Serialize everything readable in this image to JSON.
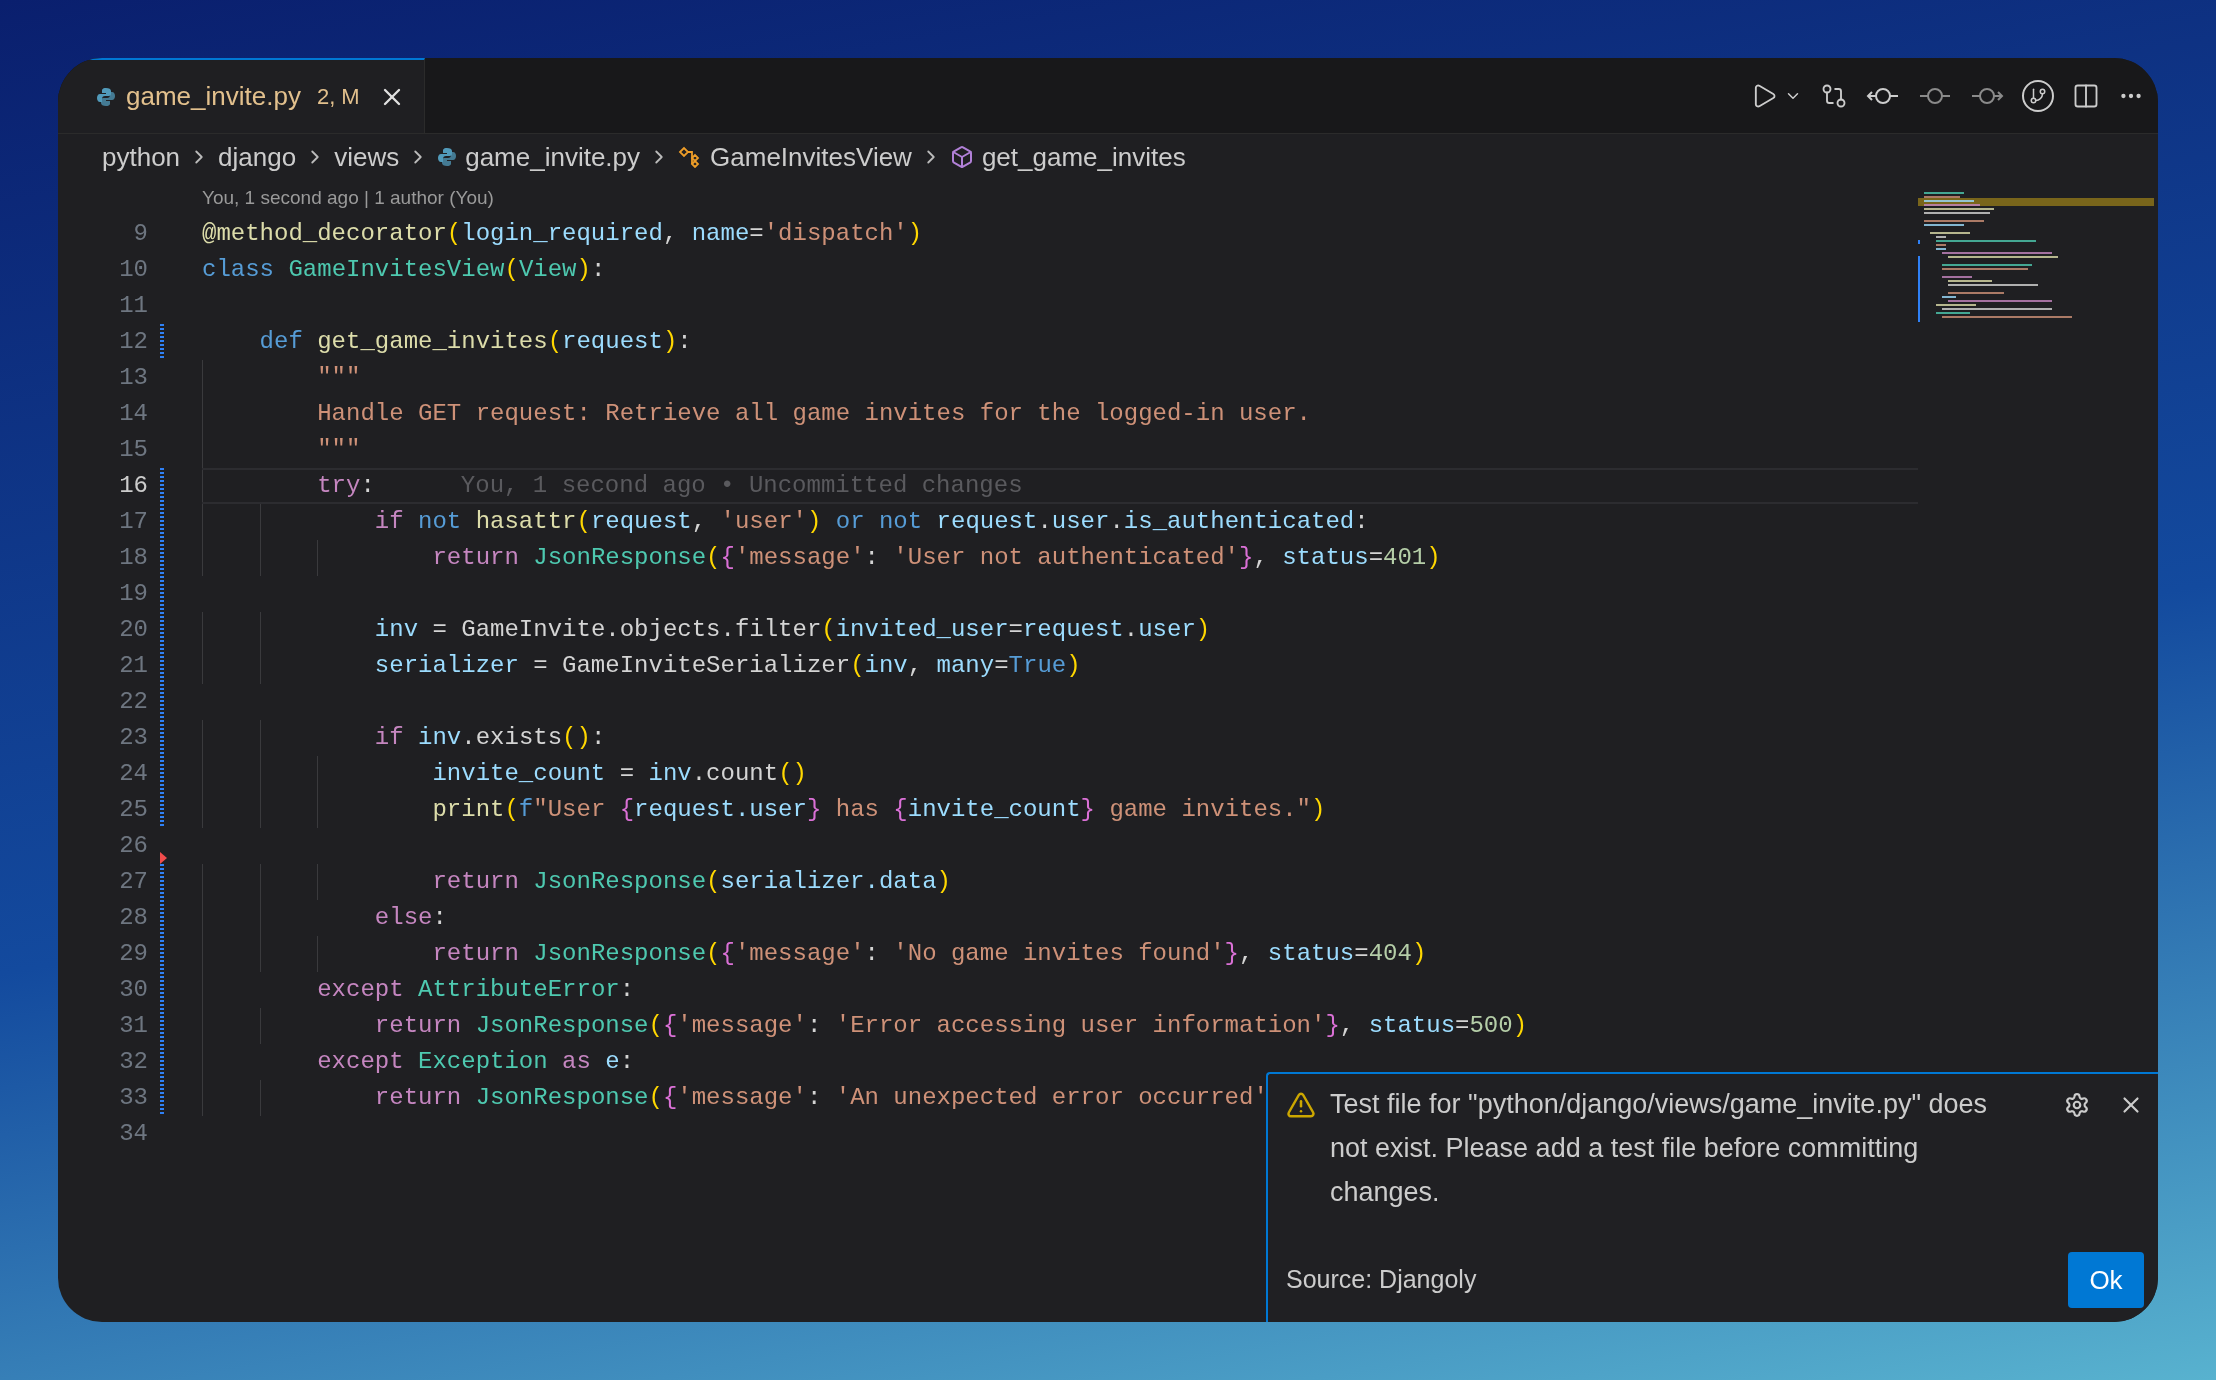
{
  "tab": {
    "label": "game_invite.py",
    "status": "2, M",
    "selected": true,
    "modified": true
  },
  "breadcrumbs": [
    {
      "label": "python",
      "kind": "folder"
    },
    {
      "label": "django",
      "kind": "folder"
    },
    {
      "label": "views",
      "kind": "folder"
    },
    {
      "label": "game_invite.py",
      "kind": "file"
    },
    {
      "label": "GameInvitesView",
      "kind": "class"
    },
    {
      "label": "get_game_invites",
      "kind": "method"
    }
  ],
  "code_lens": "You, 1 second ago | 1 author (You)",
  "lines": [
    {
      "number": "9",
      "current": false,
      "modified": false,
      "deleted": false,
      "tokens": [
        {
          "kind": "function",
          "text": "@method_decorator"
        },
        {
          "kind": "bracket",
          "text": "("
        },
        {
          "kind": "variable",
          "text": "login_required"
        },
        {
          "kind": "plain",
          "text": ", "
        },
        {
          "kind": "variable",
          "text": "name"
        },
        {
          "kind": "plain",
          "text": "="
        },
        {
          "kind": "string",
          "text": "'dispatch'"
        },
        {
          "kind": "bracket",
          "text": ")"
        }
      ]
    },
    {
      "number": "10",
      "current": false,
      "modified": false,
      "deleted": false,
      "tokens": [
        {
          "kind": "keyword",
          "text": "class "
        },
        {
          "kind": "type",
          "text": "GameInvitesView"
        },
        {
          "kind": "bracket",
          "text": "("
        },
        {
          "kind": "type",
          "text": "View"
        },
        {
          "kind": "bracket",
          "text": ")"
        },
        {
          "kind": "plain",
          "text": ":"
        }
      ]
    },
    {
      "number": "11",
      "current": false,
      "modified": false,
      "deleted": false
    },
    {
      "number": "12",
      "current": false,
      "modified": true,
      "deleted": false,
      "tokens": [
        {
          "kind": "keyword",
          "text": "    def "
        },
        {
          "kind": "function",
          "text": "get_game_invites"
        },
        {
          "kind": "bracket",
          "text": "("
        },
        {
          "kind": "variable",
          "text": "request"
        },
        {
          "kind": "bracket",
          "text": ")"
        },
        {
          "kind": "plain",
          "text": ":"
        }
      ]
    },
    {
      "number": "13",
      "current": false,
      "modified": false,
      "deleted": false,
      "tokens": [
        {
          "kind": "string",
          "text": "        \"\"\""
        }
      ]
    },
    {
      "number": "14",
      "current": false,
      "modified": false,
      "deleted": false,
      "tokens": [
        {
          "kind": "string",
          "text": "        Handle GET request: Retrieve all game invites for the logged-in user."
        }
      ]
    },
    {
      "number": "15",
      "current": false,
      "modified": false,
      "deleted": false,
      "tokens": [
        {
          "kind": "string",
          "text": "        \"\"\""
        }
      ]
    },
    {
      "number": "16",
      "current": true,
      "modified": true,
      "deleted": false,
      "blame": "You, 1 second ago • Uncommitted changes",
      "tokens": [
        {
          "kind": "control",
          "text": "        try"
        },
        {
          "kind": "plain",
          "text": ":"
        }
      ]
    },
    {
      "number": "17",
      "current": false,
      "modified": true,
      "deleted": false,
      "tokens": [
        {
          "kind": "control",
          "text": "            if "
        },
        {
          "kind": "keyword",
          "text": "not "
        },
        {
          "kind": "function",
          "text": "hasattr"
        },
        {
          "kind": "bracket",
          "text": "("
        },
        {
          "kind": "variable",
          "text": "request"
        },
        {
          "kind": "plain",
          "text": ", "
        },
        {
          "kind": "string",
          "text": "'user'"
        },
        {
          "kind": "bracket",
          "text": ")"
        },
        {
          "kind": "keyword",
          "text": " or not "
        },
        {
          "kind": "variable",
          "text": "request"
        },
        {
          "kind": "plain",
          "text": "."
        },
        {
          "kind": "variable",
          "text": "user"
        },
        {
          "kind": "plain",
          "text": "."
        },
        {
          "kind": "variable",
          "text": "is_authenticated"
        },
        {
          "kind": "plain",
          "text": ":"
        }
      ]
    },
    {
      "number": "18",
      "current": false,
      "modified": true,
      "deleted": false,
      "tokens": [
        {
          "kind": "control",
          "text": "                return "
        },
        {
          "kind": "type",
          "text": "JsonResponse"
        },
        {
          "kind": "bracket",
          "text": "("
        },
        {
          "kind": "brace",
          "text": "{"
        },
        {
          "kind": "string",
          "text": "'message'"
        },
        {
          "kind": "plain",
          "text": ": "
        },
        {
          "kind": "string",
          "text": "'User not authenticated'"
        },
        {
          "kind": "brace",
          "text": "}"
        },
        {
          "kind": "plain",
          "text": ", "
        },
        {
          "kind": "variable",
          "text": "status"
        },
        {
          "kind": "plain",
          "text": "="
        },
        {
          "kind": "number",
          "text": "401"
        },
        {
          "kind": "bracket",
          "text": ")"
        }
      ]
    },
    {
      "number": "19",
      "current": false,
      "modified": true,
      "deleted": false
    },
    {
      "number": "20",
      "current": false,
      "modified": true,
      "deleted": false,
      "tokens": [
        {
          "kind": "variable",
          "text": "            inv"
        },
        {
          "kind": "plain",
          "text": " = GameInvite.objects.filter"
        },
        {
          "kind": "bracket",
          "text": "("
        },
        {
          "kind": "variable",
          "text": "invited_user"
        },
        {
          "kind": "plain",
          "text": "="
        },
        {
          "kind": "variable",
          "text": "request"
        },
        {
          "kind": "plain",
          "text": "."
        },
        {
          "kind": "variable",
          "text": "user"
        },
        {
          "kind": "bracket",
          "text": ")"
        }
      ]
    },
    {
      "number": "21",
      "current": false,
      "modified": true,
      "deleted": false,
      "tokens": [
        {
          "kind": "variable",
          "text": "            serializer"
        },
        {
          "kind": "plain",
          "text": " = GameInviteSerializer"
        },
        {
          "kind": "bracket",
          "text": "("
        },
        {
          "kind": "variable",
          "text": "inv"
        },
        {
          "kind": "plain",
          "text": ", "
        },
        {
          "kind": "variable",
          "text": "many"
        },
        {
          "kind": "plain",
          "text": "="
        },
        {
          "kind": "keyword",
          "text": "True"
        },
        {
          "kind": "bracket",
          "text": ")"
        }
      ]
    },
    {
      "number": "22",
      "current": false,
      "modified": true,
      "deleted": false
    },
    {
      "number": "23",
      "current": false,
      "modified": true,
      "deleted": false,
      "tokens": [
        {
          "kind": "control",
          "text": "            if "
        },
        {
          "kind": "variable",
          "text": "inv"
        },
        {
          "kind": "plain",
          "text": ".exists"
        },
        {
          "kind": "bracket",
          "text": "()"
        },
        {
          "kind": "plain",
          "text": ":"
        }
      ]
    },
    {
      "number": "24",
      "current": false,
      "modified": true,
      "deleted": false,
      "tokens": [
        {
          "kind": "variable",
          "text": "                invite_count"
        },
        {
          "kind": "plain",
          "text": " = "
        },
        {
          "kind": "variable",
          "text": "inv"
        },
        {
          "kind": "plain",
          "text": ".count"
        },
        {
          "kind": "bracket",
          "text": "()"
        }
      ]
    },
    {
      "number": "25",
      "current": false,
      "modified": true,
      "deleted": false,
      "tokens": [
        {
          "kind": "function",
          "text": "                print"
        },
        {
          "kind": "bracket",
          "text": "("
        },
        {
          "kind": "keyword",
          "text": "f"
        },
        {
          "kind": "string",
          "text": "\"User "
        },
        {
          "kind": "brace",
          "text": "{"
        },
        {
          "kind": "variable",
          "text": "request.user"
        },
        {
          "kind": "brace",
          "text": "}"
        },
        {
          "kind": "string",
          "text": " has "
        },
        {
          "kind": "brace",
          "text": "{"
        },
        {
          "kind": "variable",
          "text": "invite_count"
        },
        {
          "kind": "brace",
          "text": "}"
        },
        {
          "kind": "string",
          "text": " game invites.\""
        },
        {
          "kind": "bracket",
          "text": ")"
        }
      ]
    },
    {
      "number": "26",
      "current": false,
      "modified": false,
      "deleted": true
    },
    {
      "number": "27",
      "current": false,
      "modified": true,
      "deleted": false,
      "tokens": [
        {
          "kind": "control",
          "text": "                return "
        },
        {
          "kind": "type",
          "text": "JsonResponse"
        },
        {
          "kind": "bracket",
          "text": "("
        },
        {
          "kind": "variable",
          "text": "serializer.data"
        },
        {
          "kind": "bracket",
          "text": ")"
        }
      ]
    },
    {
      "number": "28",
      "current": false,
      "modified": true,
      "deleted": false,
      "tokens": [
        {
          "kind": "control",
          "text": "            else"
        },
        {
          "kind": "plain",
          "text": ":"
        }
      ]
    },
    {
      "number": "29",
      "current": false,
      "modified": true,
      "deleted": false,
      "tokens": [
        {
          "kind": "control",
          "text": "                return "
        },
        {
          "kind": "type",
          "text": "JsonResponse"
        },
        {
          "kind": "bracket",
          "text": "("
        },
        {
          "kind": "brace",
          "text": "{"
        },
        {
          "kind": "string",
          "text": "'message'"
        },
        {
          "kind": "plain",
          "text": ": "
        },
        {
          "kind": "string",
          "text": "'No game invites found'"
        },
        {
          "kind": "brace",
          "text": "}"
        },
        {
          "kind": "plain",
          "text": ", "
        },
        {
          "kind": "variable",
          "text": "status"
        },
        {
          "kind": "plain",
          "text": "="
        },
        {
          "kind": "number",
          "text": "404"
        },
        {
          "kind": "bracket",
          "text": ")"
        }
      ]
    },
    {
      "number": "30",
      "current": false,
      "modified": true,
      "deleted": false,
      "tokens": [
        {
          "kind": "control",
          "text": "        except "
        },
        {
          "kind": "type",
          "text": "AttributeError"
        },
        {
          "kind": "plain",
          "text": ":"
        }
      ]
    },
    {
      "number": "31",
      "current": false,
      "modified": true,
      "deleted": false,
      "tokens": [
        {
          "kind": "control",
          "text": "            return "
        },
        {
          "kind": "type",
          "text": "JsonResponse"
        },
        {
          "kind": "bracket",
          "text": "("
        },
        {
          "kind": "brace",
          "text": "{"
        },
        {
          "kind": "string",
          "text": "'message'"
        },
        {
          "kind": "plain",
          "text": ": "
        },
        {
          "kind": "string",
          "text": "'Error accessing user information'"
        },
        {
          "kind": "brace",
          "text": "}"
        },
        {
          "kind": "plain",
          "text": ", "
        },
        {
          "kind": "variable",
          "text": "status"
        },
        {
          "kind": "plain",
          "text": "="
        },
        {
          "kind": "number",
          "text": "500"
        },
        {
          "kind": "bracket",
          "text": ")"
        }
      ]
    },
    {
      "number": "32",
      "current": false,
      "modified": true,
      "deleted": false,
      "tokens": [
        {
          "kind": "control",
          "text": "        except "
        },
        {
          "kind": "type",
          "text": "Exception"
        },
        {
          "kind": "control",
          "text": " as "
        },
        {
          "kind": "variable",
          "text": "e"
        },
        {
          "kind": "plain",
          "text": ":"
        }
      ]
    },
    {
      "number": "33",
      "current": false,
      "modified": true,
      "deleted": false,
      "tokens": [
        {
          "kind": "control",
          "text": "            return "
        },
        {
          "kind": "type",
          "text": "JsonResponse"
        },
        {
          "kind": "bracket",
          "text": "("
        },
        {
          "kind": "brace",
          "text": "{"
        },
        {
          "kind": "string",
          "text": "'message'"
        },
        {
          "kind": "plain",
          "text": ": "
        },
        {
          "kind": "string",
          "text": "'An unexpected error occurred'"
        }
      ]
    },
    {
      "number": "34",
      "current": false,
      "modified": false,
      "deleted": false
    }
  ],
  "notification": {
    "message": "Test file for \"python/django/views/game_invite.py\" does not exist. Please add a test file before committing changes.",
    "source": "Source: Djangoly",
    "button": "Ok"
  }
}
